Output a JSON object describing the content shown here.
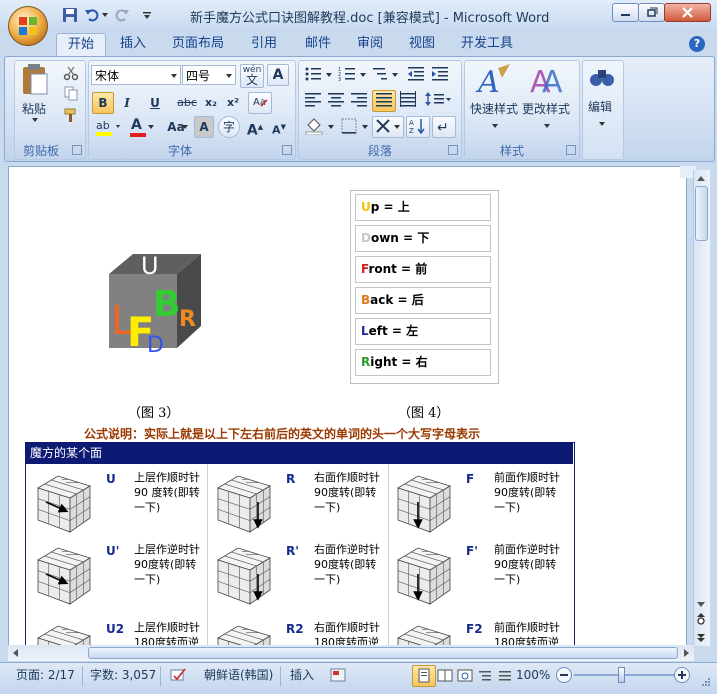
{
  "window": {
    "title": "新手魔方公式口诀图解教程.doc [兼容模式] - Microsoft Word"
  },
  "tabs": [
    "开始",
    "插入",
    "页面布局",
    "引用",
    "邮件",
    "审阅",
    "视图",
    "开发工具"
  ],
  "ribbon": {
    "clipboard": {
      "label": "剪贴板",
      "paste": "粘贴"
    },
    "font": {
      "label": "字体",
      "font_name": "宋体",
      "font_size": "四号",
      "phonetic": "wén",
      "bold": "B",
      "italic": "I",
      "underline": "U",
      "strike": "abc",
      "subscript": "x₂",
      "superscript": "x²",
      "case": "Aa",
      "font_color": "A",
      "grow": "A",
      "shrink": "A"
    },
    "paragraph": {
      "label": "段落"
    },
    "styles": {
      "label": "样式",
      "quick": "快速样式",
      "change": "更改样式"
    },
    "editing": {
      "label": "编辑"
    }
  },
  "document": {
    "definitions": [
      {
        "letter": "U",
        "rest": "p = 上",
        "color": "#f2c500"
      },
      {
        "letter": "D",
        "rest": "own = 下",
        "color": "#c8c8c8"
      },
      {
        "letter": "F",
        "rest": "ront = 前",
        "color": "#cc1f1f"
      },
      {
        "letter": "B",
        "rest": "ack = 后",
        "color": "#e07a1d"
      },
      {
        "letter": "L",
        "rest": "eft = 左",
        "color": "#1a2a9e"
      },
      {
        "letter": "R",
        "rest": "ight = 右",
        "color": "#2f9a2f"
      }
    ],
    "caption3": "（图 3）",
    "caption4": "（图 4）",
    "note": "公式说明：实际上就是以上下左右前后的英文的单词的头一个大写字母表示",
    "cube_letters": [
      "U",
      "B",
      "R",
      "L",
      "F",
      "D"
    ],
    "table_title": "魔方的某个面",
    "moves": [
      {
        "code": "U",
        "desc": [
          "上层作顺时针",
          "90 度转(即转",
          "一下)"
        ]
      },
      {
        "code": "R",
        "desc": [
          "右面作顺时针",
          "90度转(即转",
          "一下)"
        ]
      },
      {
        "code": "F",
        "desc": [
          "前面作顺时针",
          "90度转(即转",
          "一下)"
        ]
      },
      {
        "code": "U'",
        "desc": [
          "上层作逆时针",
          "90度转(即转",
          "一下)"
        ]
      },
      {
        "code": "R'",
        "desc": [
          "右面作逆时针",
          "90度转(即转",
          "一下)"
        ]
      },
      {
        "code": "F'",
        "desc": [
          "前面作逆时针",
          "90度转(即转",
          "一下)"
        ]
      },
      {
        "code": "U2",
        "desc": [
          "上层作顺时针",
          "180度转而逆"
        ]
      },
      {
        "code": "R2",
        "desc": [
          "右面作顺时针",
          "180度转而逆"
        ]
      },
      {
        "code": "F2",
        "desc": [
          "前面作顺时针",
          "180度转而逆"
        ]
      }
    ]
  },
  "status": {
    "page": "页面: 2/17",
    "words": "字数: 3,057",
    "language": "朝鲜语(韩国)",
    "mode": "插入",
    "zoom": "100%"
  },
  "colors": {
    "accent": "#15428b",
    "table_header": "#0d1a73",
    "note": "#9a3a00"
  }
}
